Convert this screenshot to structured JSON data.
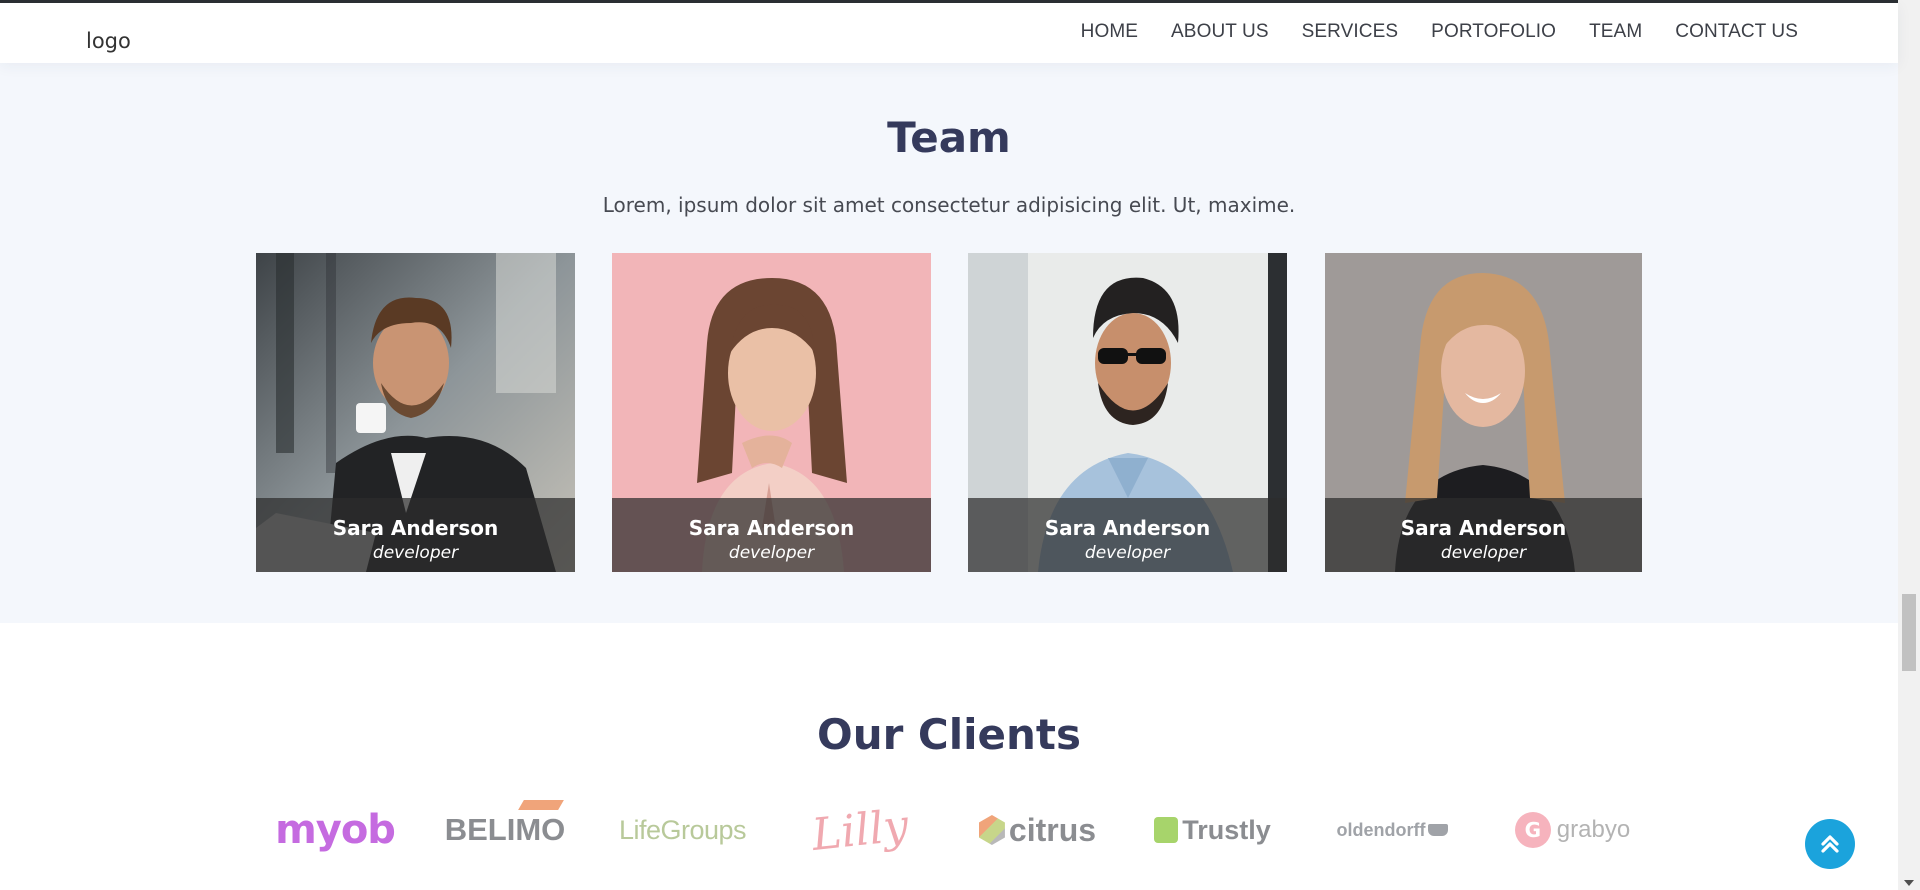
{
  "header": {
    "logo": "logo",
    "nav": [
      "HOME",
      "ABOUT US",
      "SERVICES",
      "PORTOFOLIO",
      "TEAM",
      "CONTACT US"
    ]
  },
  "team": {
    "title": "Team",
    "subtitle": "Lorem, ipsum dolor sit amet consectetur adipisicing elit. Ut, maxime.",
    "members": [
      {
        "name": "Sara Anderson",
        "role": "developer"
      },
      {
        "name": "Sara Anderson",
        "role": "developer"
      },
      {
        "name": "Sara Anderson",
        "role": "developer"
      },
      {
        "name": "Sara Anderson",
        "role": "developer"
      }
    ]
  },
  "clients": {
    "title": "Our Clients",
    "logos": [
      "myob",
      "BELIMO",
      "LifeGroups",
      "Lilly",
      "citrus",
      "Trustly",
      "oldendorff",
      "grabyo"
    ]
  },
  "colors": {
    "heading": "#353a5c",
    "team_bg": "#f4f7fc",
    "accent": "#1ba3dc"
  },
  "icons": {
    "back_to_top": "double-chevron-up-icon"
  }
}
